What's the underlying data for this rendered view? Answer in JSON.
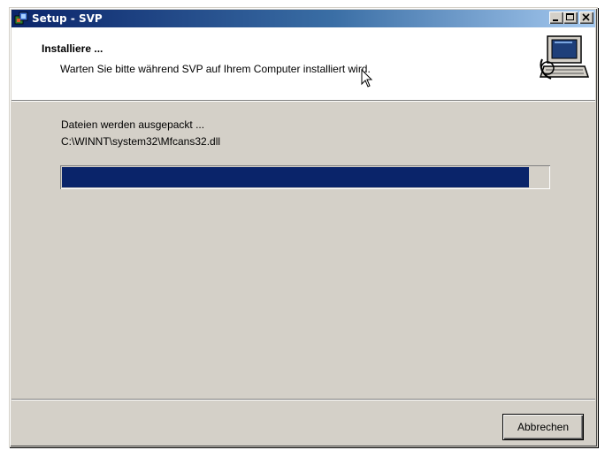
{
  "window": {
    "title": "Setup - SVP"
  },
  "header": {
    "title": "Installiere ...",
    "subtitle": "Warten Sie bitte während SVP auf Ihrem Computer installiert wird."
  },
  "status": {
    "line1": "Dateien werden ausgepackt ...",
    "line2": "C:\\WINNT\\system32\\Mfcans32.dll"
  },
  "progress": {
    "percent": 96
  },
  "buttons": {
    "cancel": "Abbrechen"
  },
  "icons": {
    "app": "setup-icon",
    "wizard": "computer-install-icon",
    "minimize": "minimize-icon",
    "maximize": "maximize-icon",
    "close": "close-icon",
    "cursor": "mouse-cursor-icon"
  },
  "colors": {
    "titlebar_start": "#0a246a",
    "titlebar_end": "#a6caf0",
    "progress_fill": "#0a246a",
    "face": "#d4d0c8"
  }
}
